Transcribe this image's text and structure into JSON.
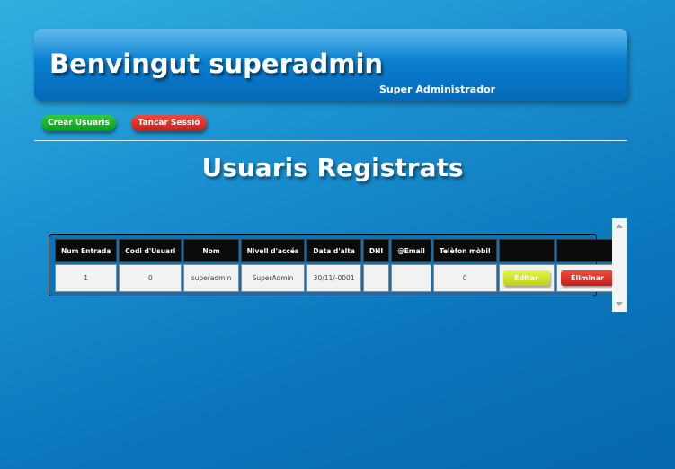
{
  "header": {
    "welcome": "Benvingut superadmin",
    "role": "Super Administrador"
  },
  "actions": {
    "create_users": "Crear Usuaris",
    "logout": "Tancar Sessió"
  },
  "main": {
    "title": "Usuaris Registrats"
  },
  "table": {
    "columns": [
      "Num Entrada",
      "Codi d'Usuari",
      "Nom",
      "Nivell d'accés",
      "Data d'alta",
      "DNI",
      "@Email",
      "Telèfon mòbil",
      "",
      ""
    ],
    "rows": [
      {
        "num_entrada": "1",
        "codi_usuari": "0",
        "nom": "superadmin",
        "nivell": "SuperAdmin",
        "data_alta": "30/11/-0001",
        "dni": "",
        "email": "",
        "telefon": "0",
        "edit_label": "Editar",
        "delete_label": "Eliminar"
      }
    ]
  },
  "colors": {
    "background": "#0b7fc4",
    "green_button": "#14a322",
    "red_button": "#d62a22",
    "yellow_button": "#d0e42a"
  }
}
